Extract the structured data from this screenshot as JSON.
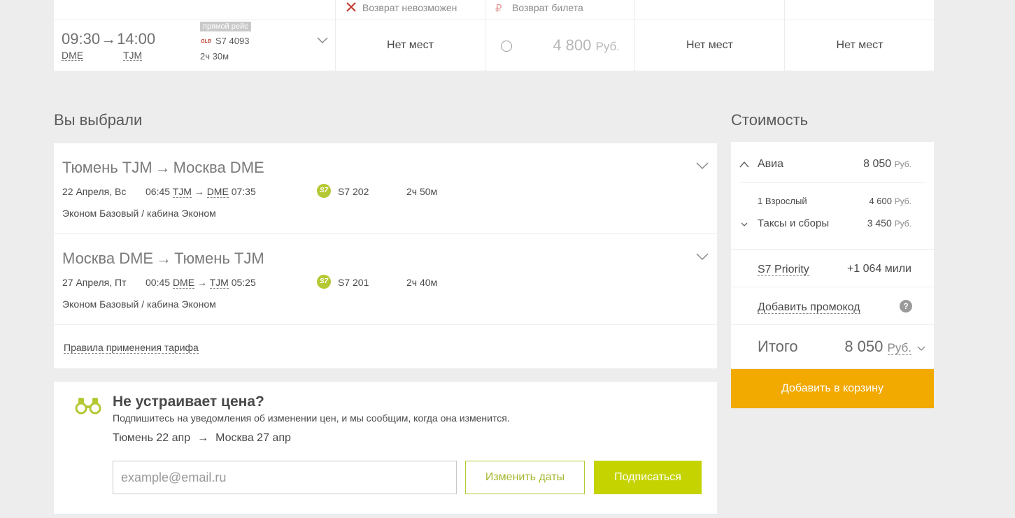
{
  "flight_row": {
    "dep_time": "09:30",
    "arr_time": "14:00",
    "dep_code": "DME",
    "arr_code": "TJM",
    "direct_badge": "прямой рейс",
    "flight_no": "S7 4093",
    "duration": "2ч 30м",
    "fares": [
      {
        "header": "Возврат невозможен",
        "value": "Нет мест"
      },
      {
        "header": "Возврат билета",
        "price": "4 800",
        "currency": "Руб."
      },
      {
        "header": "",
        "value": "Нет мест"
      },
      {
        "header": "",
        "value": "Нет мест"
      }
    ]
  },
  "chosen": {
    "title": "Вы выбрали",
    "segments": [
      {
        "from": "Тюмень TJM",
        "to": "Москва DME",
        "date": "22 Апреля, Вс",
        "dep_time": "06:45",
        "dep_code": "TJM",
        "arr_code": "DME",
        "arr_time": "07:35",
        "flight": "S7 202",
        "duration": "2ч 50м",
        "class": "Эконом Базовый / кабина Эконом"
      },
      {
        "from": "Москва DME",
        "to": "Тюмень TJM",
        "date": "27 Апреля, Пт",
        "dep_time": "00:45",
        "dep_code": "DME",
        "arr_code": "TJM",
        "arr_time": "05:25",
        "flight": "S7 201",
        "duration": "2ч 40м",
        "class": "Эконом Базовый / кабина Эконом"
      }
    ],
    "fare_rules": "Правила применения тарифа",
    "airline_logo": "S7"
  },
  "subscribe": {
    "title": "Не устраивает цена?",
    "desc": "Подпишитесь на уведомления об изменении цен, и мы сообщим, когда она изменится.",
    "route_from": "Тюмень 22 апр",
    "route_to": "Москва 27 апр",
    "email_placeholder": "example@email.ru",
    "change_dates": "Изменить даты",
    "subscribe_btn": "Подписаться"
  },
  "price": {
    "title": "Стоимость",
    "avia_label": "Авиа",
    "avia_value": "8 050",
    "currency": "Руб.",
    "adult_label": "1 Взрослый",
    "adult_value": "4 600",
    "taxes_label": "Таксы и сборы",
    "taxes_value": "3 450",
    "priority_label": "S7 Priority",
    "priority_miles": "+1 064 мили",
    "promo_label": "Добавить промокод",
    "help": "?",
    "total_label": "Итого",
    "total_value": "8 050",
    "cart_btn": "Добавить в корзину"
  },
  "colors": {
    "accent_green": "#c5d300",
    "cart_orange": "#f2a900",
    "cancel_red": "#c0392b"
  }
}
